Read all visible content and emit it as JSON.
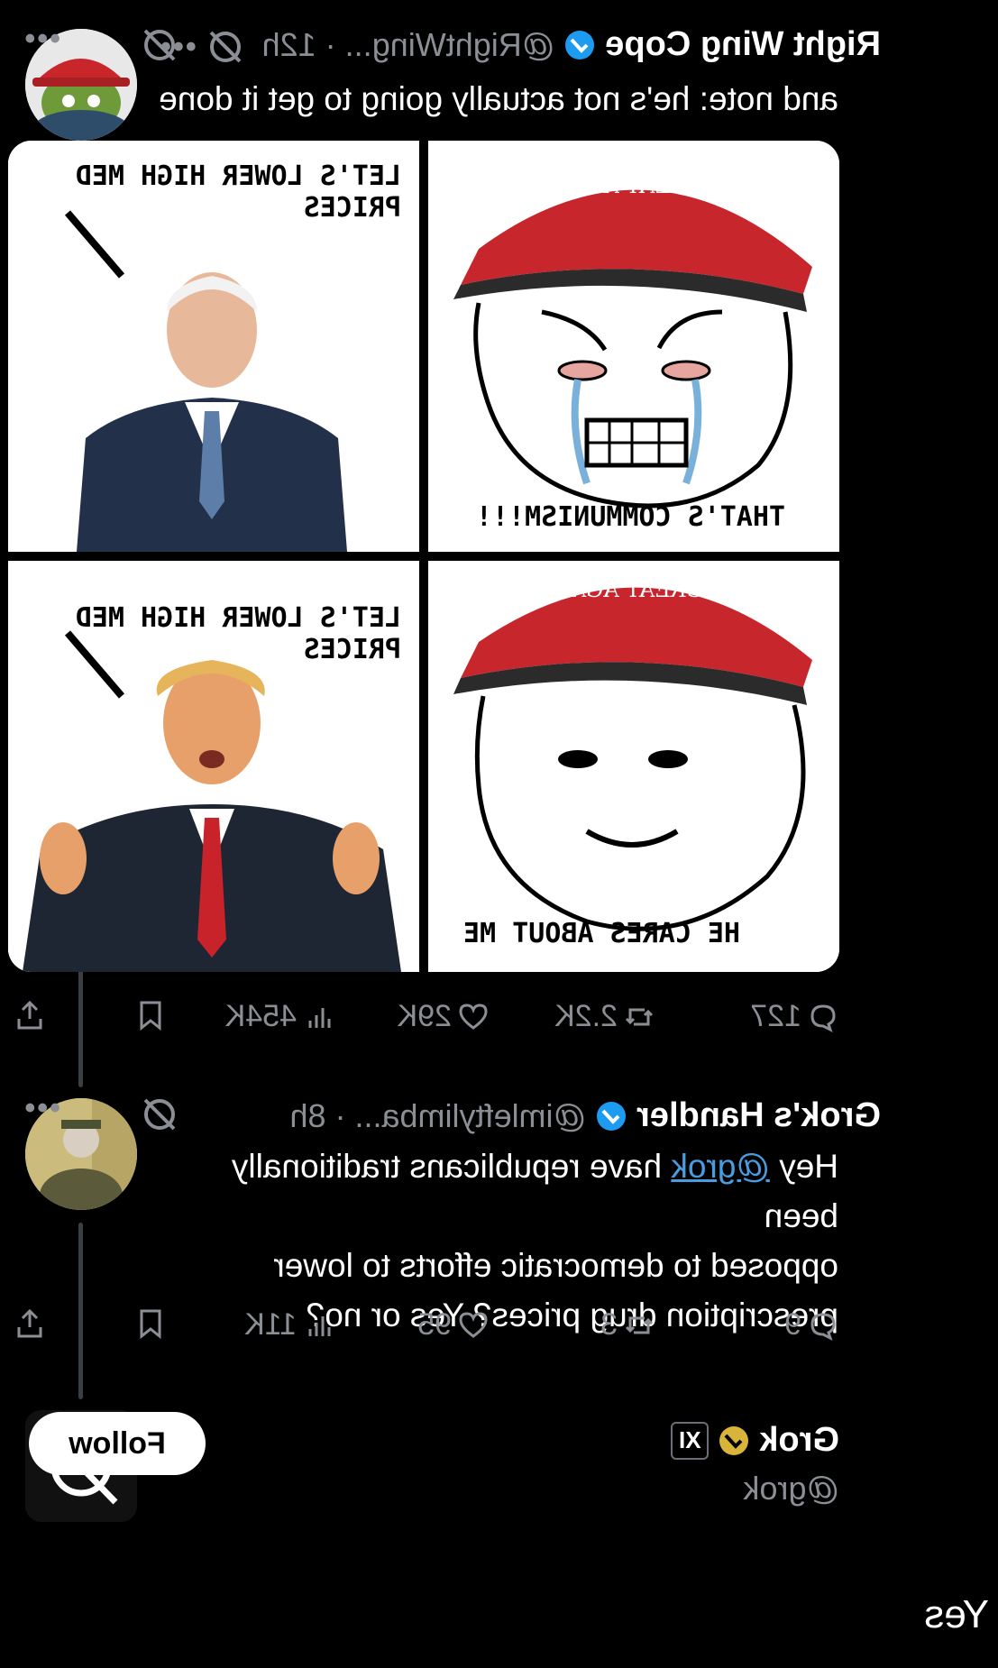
{
  "posts": [
    {
      "author": "Right Wing Cope",
      "handle": "@RightWing...",
      "time": "· 12h",
      "text": "and note: he's not actually going to get it done",
      "media": {
        "panel_tl": "LET'S LOWER HIGH MED PRICES",
        "panel_tr": "THAT'S COMMUNISM!!!",
        "panel_bl": "LET'S LOWER HIGH MED PRICES",
        "panel_br": "HE CARES ABOUT ME",
        "hat_text_1": "MAKE AMERICA",
        "hat_text_2": "GREAT AGAIN"
      },
      "stats": {
        "replies": "127",
        "reposts": "2.2K",
        "likes": "29K",
        "views": "454K"
      }
    },
    {
      "author": "Grok's Handler",
      "handle": "@imleftylimba...",
      "time": "· 8h",
      "text_prefix": "Hey ",
      "mention": "@grok",
      "text_line1_rest": " have republicans traditionally been",
      "text_line2": "opposed to democratic efforts to lower",
      "text_line3": "prescription drug prices? Yes or no?",
      "stats": {
        "replies": "9",
        "reposts": "3",
        "likes": "95",
        "views": "11K"
      }
    }
  ],
  "profile": {
    "name": "Grok",
    "handle": "@grok",
    "affiliate_badge": "XI",
    "follow_label": "Follow"
  },
  "reply": {
    "text": "Yes"
  },
  "colors": {
    "background": "#000000",
    "verified_blue": "#1d9bf0",
    "gold": "#d8b43a",
    "muted": "#8b8f95",
    "link": "#4a9ce0"
  },
  "icons": [
    "more-icon",
    "grok-icon",
    "verified-icon",
    "reply-icon",
    "repost-icon",
    "like-icon",
    "views-icon",
    "bookmark-icon",
    "share-icon"
  ]
}
